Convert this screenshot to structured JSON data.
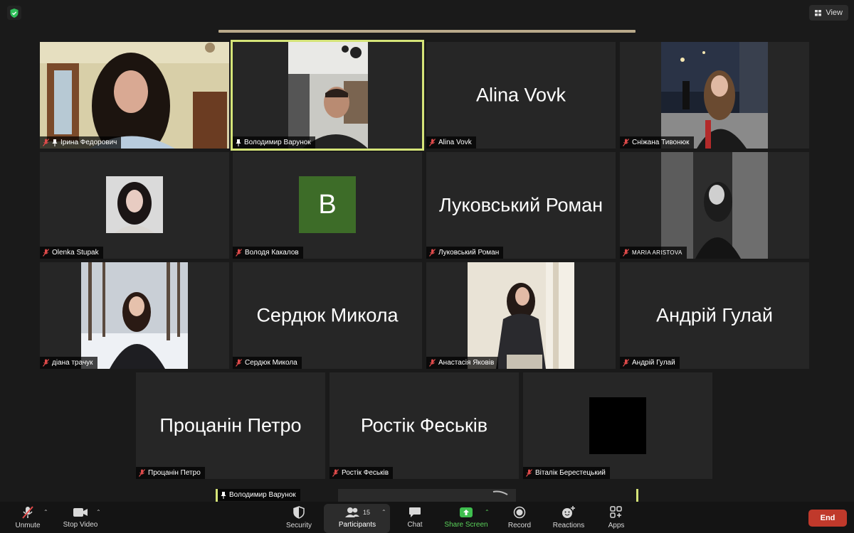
{
  "header": {
    "view_label": "View"
  },
  "tiles": [
    {
      "name": "Ірина Федорович"
    },
    {
      "name": "Володимир Варунок"
    },
    {
      "name": "Alina Vovk",
      "big": "Alina Vovk"
    },
    {
      "name": "Сніжана Тивонюк"
    },
    {
      "name": "Olenka Stupak"
    },
    {
      "name": "Володя Какалов",
      "initial": "B"
    },
    {
      "name": "Луковський Роман",
      "big": "Луковський Роман"
    },
    {
      "name": "MARIA ARISTOVA"
    },
    {
      "name": "діана трачук"
    },
    {
      "name": "Сердюк Микола",
      "big": "Сердюк Микола"
    },
    {
      "name": "Анастасія Яковів"
    },
    {
      "name": "Андрій Гулай",
      "big": "Андрій Гулай"
    },
    {
      "name": "Процанін Петро",
      "big": "Процанін Петро"
    },
    {
      "name": "Ростік Феськів",
      "big": "Ростік Феськів"
    },
    {
      "name": "Віталік Берестецький"
    }
  ],
  "bottom_pin": {
    "name": "Володимир Варунок"
  },
  "toolbar": {
    "unmute": "Unmute",
    "stop_video": "Stop Video",
    "security": "Security",
    "participants": "Participants",
    "participants_count": "15",
    "chat": "Chat",
    "share_screen": "Share Screen",
    "record": "Record",
    "reactions": "Reactions",
    "apps": "Apps",
    "end": "End"
  },
  "colors": {
    "active_speaker": "#d5e478",
    "end": "#c0392b",
    "share": "#5ad35a",
    "avatar": "#3d6c28"
  }
}
